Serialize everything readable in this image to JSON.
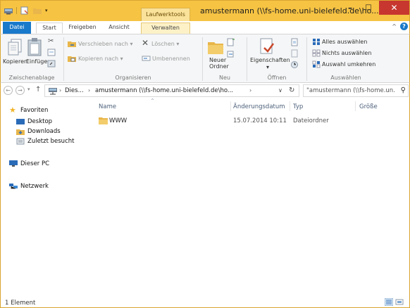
{
  "window": {
    "title": "amustermann (\\\\fs-home.uni-bielefeld.de\\ho...",
    "tools_tab_label": "Laufwerktools",
    "minimize": "–",
    "maximize": "□",
    "close": "✕"
  },
  "tabs": {
    "file": "Datei",
    "start": "Start",
    "share": "Freigeben",
    "view": "Ansicht",
    "manage": "Verwalten",
    "collapse": "^",
    "help": "?"
  },
  "ribbon": {
    "clipboard": {
      "copy": "Kopieren",
      "paste": "Einfügen",
      "group": "Zwischenablage"
    },
    "organize": {
      "move_to": "Verschieben nach",
      "copy_to": "Kopieren nach",
      "delete": "Löschen",
      "rename": "Umbenennen",
      "group": "Organisieren",
      "dropdown": "▾"
    },
    "new": {
      "new_folder_line1": "Neuer",
      "new_folder_line2": "Ordner",
      "group": "Neu"
    },
    "open": {
      "properties": "Eigenschaften",
      "dropdown": "▾",
      "group": "Öffnen"
    },
    "select": {
      "select_all": "Alles auswählen",
      "select_none": "Nichts auswählen",
      "invert": "Auswahl umkehren",
      "group": "Auswählen"
    }
  },
  "nav": {
    "back": "←",
    "forward": "→",
    "recent": "▾",
    "up": "↑",
    "breadcrumb_pc": "Dies...",
    "breadcrumb_sep": "›",
    "breadcrumb_share": "amustermann (\\\\fs-home.uni-bielefeld.de\\ho...",
    "breadcrumb_end": "›",
    "address_dropdown": "∨",
    "refresh": "↻",
    "search_placeholder": "\"amustermann (\\\\fs-home.un...",
    "search_glyph": "⚲"
  },
  "sidebar": {
    "favorites": "Favoriten",
    "items": [
      {
        "label": "Desktop"
      },
      {
        "label": "Downloads"
      },
      {
        "label": "Zuletzt besucht"
      }
    ],
    "this_pc": "Dieser PC",
    "network": "Netzwerk"
  },
  "columns": {
    "name": "Name",
    "modified": "Änderungsdatum",
    "type": "Typ",
    "size": "Größe",
    "sort_indicator": "^"
  },
  "files": [
    {
      "name": "WWW",
      "modified": "15.07.2014 10:11",
      "type": "Dateiordner",
      "size": ""
    }
  ],
  "status": {
    "count": "1 Element"
  },
  "colors": {
    "title_bar": "#f6c343",
    "file_tab": "#1979ca",
    "close_button": "#c7372f",
    "folder": "#e8b64b"
  }
}
